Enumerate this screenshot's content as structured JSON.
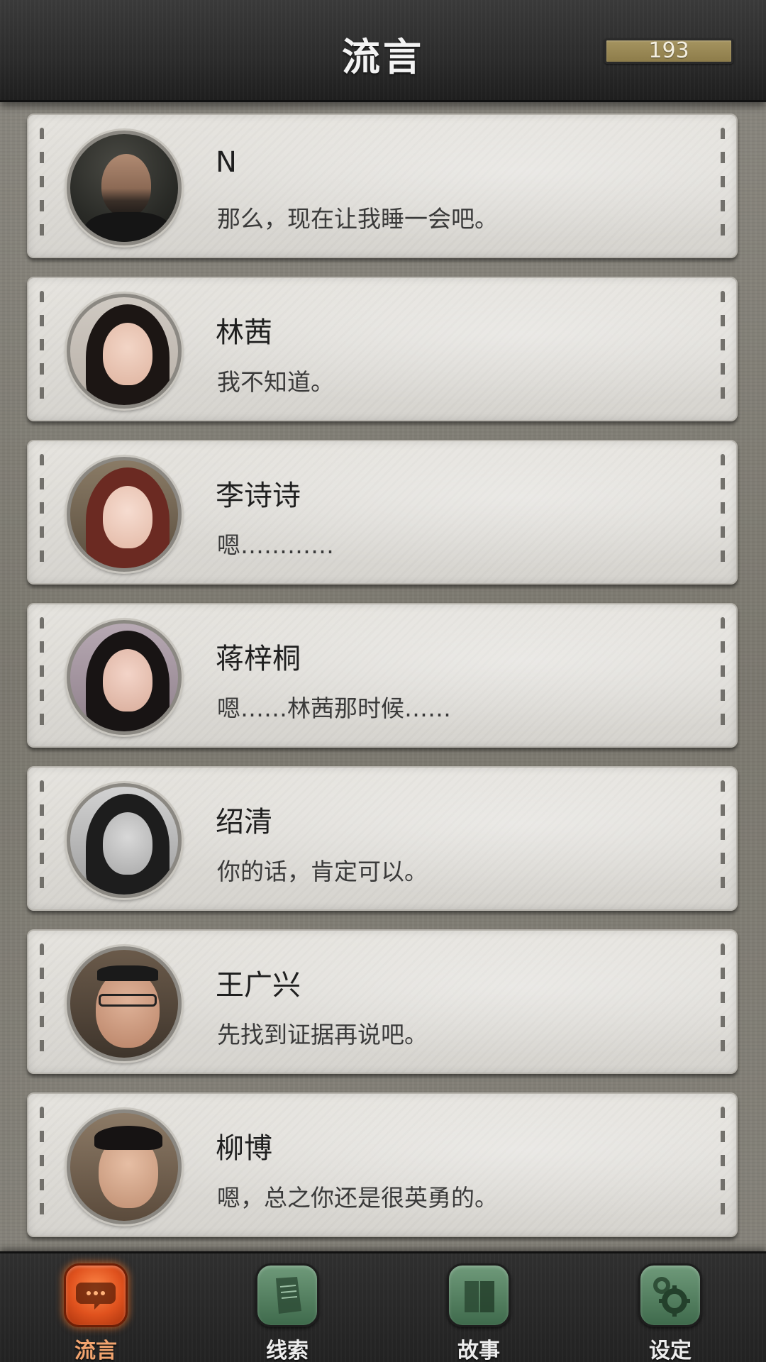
{
  "header": {
    "title": "流言",
    "counter": "193"
  },
  "messages": [
    {
      "name": "N",
      "text": "那么，现在让我睡一会吧。",
      "avatar": "avatar-n"
    },
    {
      "name": "林茜",
      "text": "我不知道。",
      "avatar": "avatar-linqian"
    },
    {
      "name": "李诗诗",
      "text": "嗯…………",
      "avatar": "avatar-lishishi"
    },
    {
      "name": "蒋梓桐",
      "text": "嗯……林茜那时候……",
      "avatar": "avatar-jiangzitong"
    },
    {
      "name": "绍清",
      "text": "你的话，肯定可以。",
      "avatar": "avatar-shaoqing"
    },
    {
      "name": "王广兴",
      "text": "先找到证据再说吧。",
      "avatar": "avatar-wangguangxing"
    },
    {
      "name": "柳博",
      "text": "嗯，总之你还是很英勇的。",
      "avatar": "avatar-liubo"
    }
  ],
  "tabs": [
    {
      "label": "流言",
      "icon": "chat-bubble-icon",
      "active": true
    },
    {
      "label": "线索",
      "icon": "paper-clue-icon",
      "active": false
    },
    {
      "label": "故事",
      "icon": "book-icon",
      "active": false
    },
    {
      "label": "设定",
      "icon": "gear-icon",
      "active": false
    }
  ]
}
